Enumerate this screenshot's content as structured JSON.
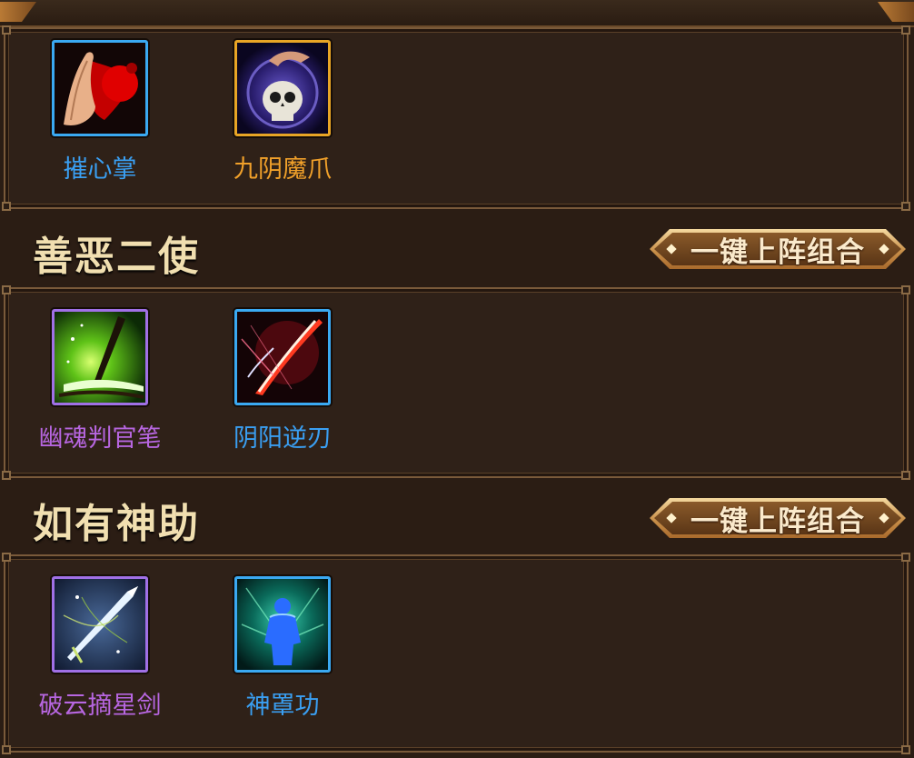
{
  "panels": [
    {
      "title": "",
      "skills": [
        {
          "name": "摧心掌",
          "quality": "blue",
          "icon": "bloody-palm-icon"
        },
        {
          "name": "九阴魔爪",
          "quality": "gold",
          "icon": "skull-claw-icon"
        }
      ]
    },
    {
      "title": "善恶二使",
      "combo_button": "一键上阵组合",
      "skills": [
        {
          "name": "幽魂判官笔",
          "quality": "purple",
          "icon": "ghost-brush-icon"
        },
        {
          "name": "阴阳逆刃",
          "quality": "blue",
          "icon": "yinyang-blade-icon"
        }
      ]
    },
    {
      "title": "如有神助",
      "combo_button": "一键上阵组合",
      "skills": [
        {
          "name": "破云摘星剑",
          "quality": "purple",
          "icon": "star-sword-icon"
        },
        {
          "name": "神罩功",
          "quality": "blue",
          "icon": "divine-aura-icon"
        }
      ]
    }
  ],
  "colors": {
    "blue": "#3a9ff2",
    "gold": "#f0a02a",
    "purple": "#b766e0",
    "title": "#f1dfb0"
  }
}
